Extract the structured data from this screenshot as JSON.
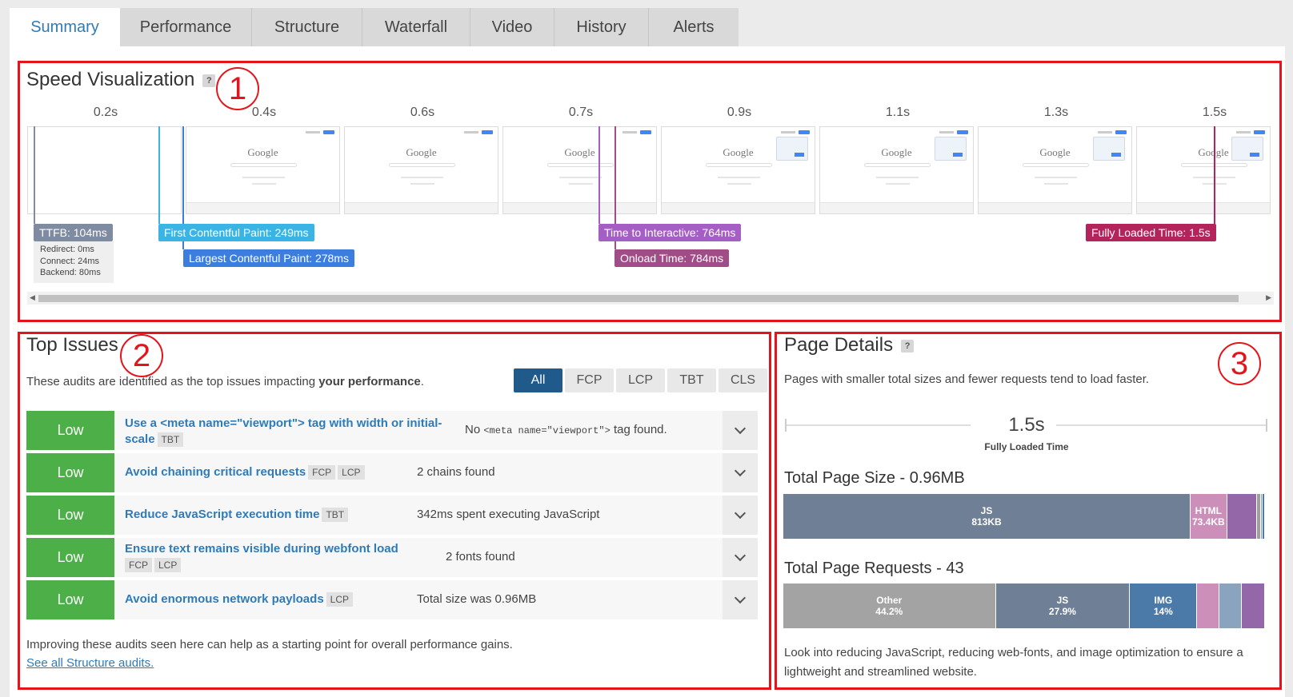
{
  "tabs": [
    {
      "label": "Summary",
      "active": true
    },
    {
      "label": "Performance"
    },
    {
      "label": "Structure"
    },
    {
      "label": "Waterfall"
    },
    {
      "label": "Video"
    },
    {
      "label": "History"
    },
    {
      "label": "Alerts"
    }
  ],
  "annotations": [
    "1",
    "2",
    "3"
  ],
  "speed": {
    "title": "Speed Visualization",
    "help": "?",
    "times": [
      "0.2s",
      "0.4s",
      "0.6s",
      "0.7s",
      "0.9s",
      "1.1s",
      "1.3s",
      "1.5s"
    ],
    "frame_logo": "Google",
    "metrics": {
      "ttfb": "TTFB: 104ms",
      "fcp": "First Contentful Paint: 249ms",
      "lcp": "Largest Contentful Paint: 278ms",
      "tti": "Time to Interactive: 764ms",
      "onload": "Onload Time: 784ms",
      "fully": "Fully Loaded Time: 1.5s"
    },
    "ttfb_detail": [
      "Redirect: 0ms",
      "Connect: 24ms",
      "Backend: 80ms"
    ],
    "colors": {
      "ttfb": "#7f8ba0",
      "fcp": "#3ab4e5",
      "lcp": "#3c7ee0",
      "tti": "#a55fc4",
      "onload": "#a04c86",
      "fully": "#b3245c"
    }
  },
  "issues": {
    "title": "Top Issues",
    "intro_pre": "These audits are identified as the top issues impacting ",
    "intro_bold": "your performance",
    "intro_post": ".",
    "filters": [
      "All",
      "FCP",
      "LCP",
      "TBT",
      "CLS"
    ],
    "rows": [
      {
        "severity": "Low",
        "title": "Use a <meta name=\"viewport\"> tag with width or initial-scale",
        "tags": [
          "TBT"
        ],
        "desc_pre": "No ",
        "desc_code": "<meta name=\"viewport\">",
        "desc_post": " tag found."
      },
      {
        "severity": "Low",
        "title": "Avoid chaining critical requests",
        "tags": [
          "FCP",
          "LCP"
        ],
        "desc": "2 chains found"
      },
      {
        "severity": "Low",
        "title": "Reduce JavaScript execution time",
        "tags": [
          "TBT"
        ],
        "desc": "342ms spent executing JavaScript"
      },
      {
        "severity": "Low",
        "title": "Ensure text remains visible during webfont load",
        "tags": [
          "FCP",
          "LCP"
        ],
        "desc": "2 fonts found"
      },
      {
        "severity": "Low",
        "title": "Avoid enormous network payloads",
        "tags": [
          "LCP"
        ],
        "desc": "Total size was 0.96MB"
      }
    ],
    "footer": "Improving these audits seen here can help as a starting point for overall performance gains.",
    "link": "See all Structure audits."
  },
  "details": {
    "title": "Page Details",
    "help": "?",
    "intro": "Pages with smaller total sizes and fewer requests tend to load faster.",
    "fully_loaded_value": "1.5s",
    "fully_loaded_label": "Fully Loaded Time",
    "size_title": "Total Page Size - 0.96MB",
    "size_segments": [
      {
        "label": "JS",
        "value": "813KB",
        "share": 0.847,
        "color": "#6f7f96"
      },
      {
        "label": "HTML",
        "value": "73.4KB",
        "share": 0.076,
        "color": "#cc8fba"
      },
      {
        "label": "",
        "value": "",
        "share": 0.062,
        "color": "#9467a8"
      },
      {
        "label": "",
        "value": "",
        "share": 0.008,
        "color": "#9f9f9f"
      },
      {
        "label": "",
        "value": "",
        "share": 0.004,
        "color": "#8aa3bf"
      },
      {
        "label": "",
        "value": "",
        "share": 0.003,
        "color": "#4c7aa8"
      }
    ],
    "requests_title": "Total Page Requests - 43",
    "request_segments": [
      {
        "label": "Other",
        "value": "44.2%",
        "share": 0.442,
        "color": "#a3a3a3"
      },
      {
        "label": "JS",
        "value": "27.9%",
        "share": 0.279,
        "color": "#6f7f96"
      },
      {
        "label": "IMG",
        "value": "14%",
        "share": 0.14,
        "color": "#4c7aa8"
      },
      {
        "label": "",
        "value": "",
        "share": 0.046,
        "color": "#cc8fba"
      },
      {
        "label": "",
        "value": "",
        "share": 0.046,
        "color": "#8aa3bf"
      },
      {
        "label": "",
        "value": "",
        "share": 0.047,
        "color": "#9467a8"
      }
    ],
    "footer": "Look into reducing JavaScript, reducing web-fonts, and image optimization to ensure a lightweight and streamlined website."
  }
}
